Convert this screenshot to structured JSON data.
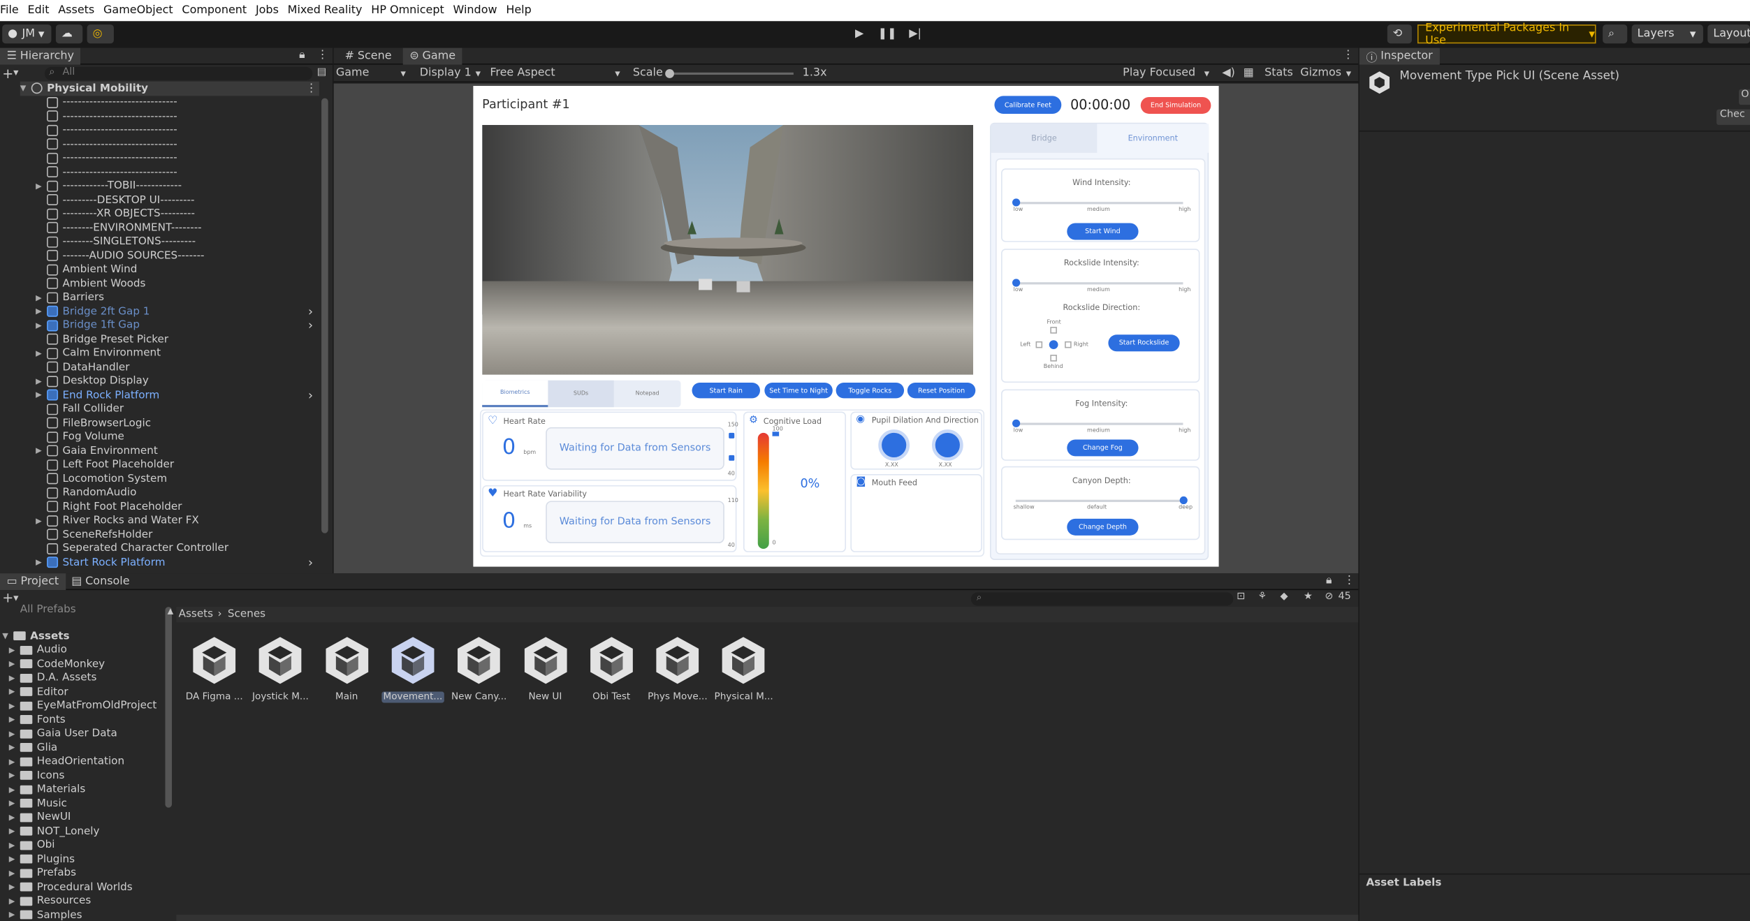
{
  "menu": [
    "File",
    "Edit",
    "Assets",
    "GameObject",
    "Component",
    "Jobs",
    "Mixed Reality",
    "HP Omnicept",
    "Window",
    "Help"
  ],
  "toolbar": {
    "account": "JM",
    "experimental": "Experimental Packages In Use",
    "layers": "Layers",
    "layout": "Layout"
  },
  "hierarchy": {
    "tab": "Hierarchy",
    "search_placeholder": "All",
    "scene": "Physical Mobility",
    "items": [
      {
        "label": "------------------------------",
        "arrow": ""
      },
      {
        "label": "------------------------------",
        "arrow": ""
      },
      {
        "label": "------------------------------",
        "arrow": ""
      },
      {
        "label": "------------------------------",
        "arrow": ""
      },
      {
        "label": "------------------------------",
        "arrow": ""
      },
      {
        "label": "------------------------------",
        "arrow": ""
      },
      {
        "label": "------------TOBII------------",
        "arrow": "▶"
      },
      {
        "label": "---------DESKTOP UI---------",
        "arrow": ""
      },
      {
        "label": "---------XR OBJECTS---------",
        "arrow": ""
      },
      {
        "label": "--------ENVIRONMENT--------",
        "arrow": ""
      },
      {
        "label": "--------SINGLETONS---------",
        "arrow": ""
      },
      {
        "label": "-------AUDIO SOURCES-------",
        "arrow": ""
      },
      {
        "label": "Ambient Wind",
        "arrow": ""
      },
      {
        "label": "Ambient Woods",
        "arrow": ""
      },
      {
        "label": "Barriers",
        "arrow": "▶"
      },
      {
        "label": "Bridge 2ft Gap 1",
        "arrow": "▶",
        "prefab": true,
        "dim": true
      },
      {
        "label": "Bridge 1ft Gap",
        "arrow": "▶",
        "prefab": true,
        "dim": true
      },
      {
        "label": "Bridge Preset Picker",
        "arrow": ""
      },
      {
        "label": "Calm Environment",
        "arrow": "▶"
      },
      {
        "label": "DataHandler",
        "arrow": ""
      },
      {
        "label": "Desktop Display",
        "arrow": "▶"
      },
      {
        "label": "End Rock Platform",
        "arrow": "▶",
        "prefab": true
      },
      {
        "label": "Fall Collider",
        "arrow": ""
      },
      {
        "label": "FileBrowserLogic",
        "arrow": ""
      },
      {
        "label": "Fog Volume",
        "arrow": ""
      },
      {
        "label": "Gaia Environment",
        "arrow": "▶"
      },
      {
        "label": "Left Foot Placeholder",
        "arrow": ""
      },
      {
        "label": "Locomotion System",
        "arrow": ""
      },
      {
        "label": "RandomAudio",
        "arrow": ""
      },
      {
        "label": "Right Foot Placeholder",
        "arrow": ""
      },
      {
        "label": "River Rocks and Water FX",
        "arrow": "▶"
      },
      {
        "label": "SceneRefsHolder",
        "arrow": ""
      },
      {
        "label": "Seperated Character Controller",
        "arrow": ""
      },
      {
        "label": "Start Rock Platform",
        "arrow": "▶",
        "prefab": true
      }
    ]
  },
  "game": {
    "tabs": [
      "Scene",
      "Game"
    ],
    "mode": "Game",
    "display": "Display 1",
    "aspect": "Free Aspect",
    "scale_label": "Scale",
    "scale_value": "1.3x",
    "play_focused": "Play Focused",
    "stats": "Stats",
    "gizmos": "Gizmos"
  },
  "sim": {
    "participant": "Participant #1",
    "calibrate": "Calibrate Feet",
    "timer": "00:00:00",
    "end": "End Simulation",
    "tabs": [
      "Biometrics",
      "SUDs",
      "Notepad"
    ],
    "actions": [
      "Start Rain",
      "Set Time to Night",
      "Toggle Rocks",
      "Reset Position"
    ],
    "heart_rate": {
      "title": "Heart Rate",
      "value": "0",
      "unit": "bpm",
      "status": "Waiting for Data from Sensors",
      "max": "150",
      "min": "40"
    },
    "hrv": {
      "title": "Heart Rate Variability",
      "value": "0",
      "unit": "ms",
      "status": "Waiting for Data from Sensors",
      "max": "110",
      "min": "40"
    },
    "cognitive": {
      "title": "Cognitive Load",
      "value": "0%",
      "top": "100",
      "bottom": "0"
    },
    "pupil": {
      "title": "Pupil Dilation And Direction",
      "left": "X.XX",
      "right": "X.XX"
    },
    "mouth": {
      "title": "Mouth Feed"
    },
    "right_tabs": [
      "Bridge",
      "Environment"
    ],
    "wind": {
      "title": "Wind Intensity:",
      "low": "low",
      "mid": "medium",
      "high": "high",
      "button": "Start Wind",
      "level": 0.0
    },
    "rockslide": {
      "title": "Rockslide Intensity:",
      "low": "low",
      "mid": "medium",
      "high": "high",
      "direction": "Rockslide Direction:",
      "front": "Front",
      "left": "Left",
      "right": "Right",
      "behind": "Behind",
      "button": "Start Rockslide",
      "level": 0.0
    },
    "fog": {
      "title": "Fog Intensity:",
      "low": "low",
      "mid": "medium",
      "high": "high",
      "button": "Change Fog",
      "level": 0.0
    },
    "canyon": {
      "title": "Canyon Depth:",
      "low": "shallow",
      "mid": "default",
      "high": "deep",
      "button": "Change Depth",
      "level": 1.0
    }
  },
  "inspector": {
    "tab": "Inspector",
    "title": "Movement Type Pick UI (Scene Asset)",
    "open": "O",
    "check": "Chec",
    "labels": "Asset Labels"
  },
  "project": {
    "tabs": [
      "Project",
      "Console"
    ],
    "tree_top": "All Prefabs",
    "root": "Assets",
    "folders": [
      "Audio",
      "CodeMonkey",
      "D.A. Assets",
      "Editor",
      "EyeMatFromOldProject",
      "Fonts",
      "Gaia User Data",
      "Glia",
      "HeadOrientation",
      "Icons",
      "Materials",
      "Music",
      "NewUI",
      "NOT_Lonely",
      "Obi",
      "Plugins",
      "Prefabs",
      "Procedural Worlds",
      "Resources",
      "Samples"
    ],
    "breadcrumb": [
      "Assets",
      "Scenes"
    ],
    "count": "45",
    "assets": [
      "DA Figma ...",
      "Joystick M...",
      "Main",
      "Movement...",
      "New Cany...",
      "New UI",
      "Obi Test",
      "Phys Move...",
      "Physical M..."
    ]
  }
}
